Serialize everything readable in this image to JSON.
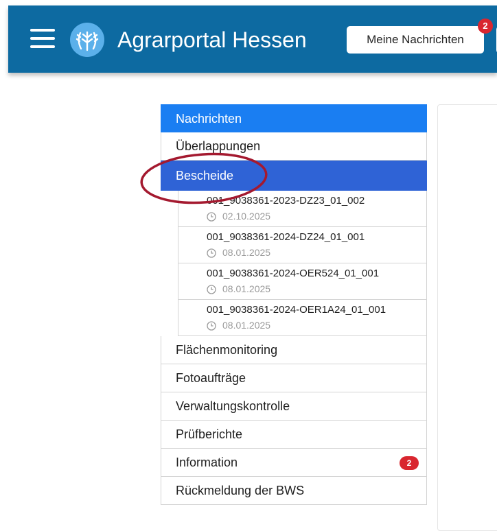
{
  "header": {
    "app_title": "Agrarportal Hessen",
    "messages_button": "Meine Nachrichten",
    "messages_count": "2",
    "menu_icon": "hamburger-menu-icon",
    "logo_icon": "wheat-logo-icon"
  },
  "nav": {
    "nachrichten": "Nachrichten",
    "ueberlappungen": "Überlappungen",
    "bescheide": "Bescheide",
    "bescheide_items": [
      {
        "title": "001_9038361-2023-DZ23_01_002",
        "date": "02.10.2025"
      },
      {
        "title": "001_9038361-2024-DZ24_01_001",
        "date": "08.01.2025"
      },
      {
        "title": "001_9038361-2024-OER524_01_001",
        "date": "08.01.2025"
      },
      {
        "title": "001_9038361-2024-OER1A24_01_001",
        "date": "08.01.2025"
      }
    ],
    "flaechenmonitoring": "Flächenmonitoring",
    "fotoauftraege": "Fotoaufträge",
    "verwaltungskontrolle": "Verwaltungskontrolle",
    "pruefberichte": "Prüfberichte",
    "information": "Information",
    "information_badge": "2",
    "rueckmeldung": "Rückmeldung der BWS"
  },
  "colors": {
    "header_bg": "#0d6aa1",
    "nav_primary": "#1a7ef2",
    "nav_active": "#2f63d6",
    "badge": "#d9262f",
    "annotation_circle": "#a4192f"
  }
}
